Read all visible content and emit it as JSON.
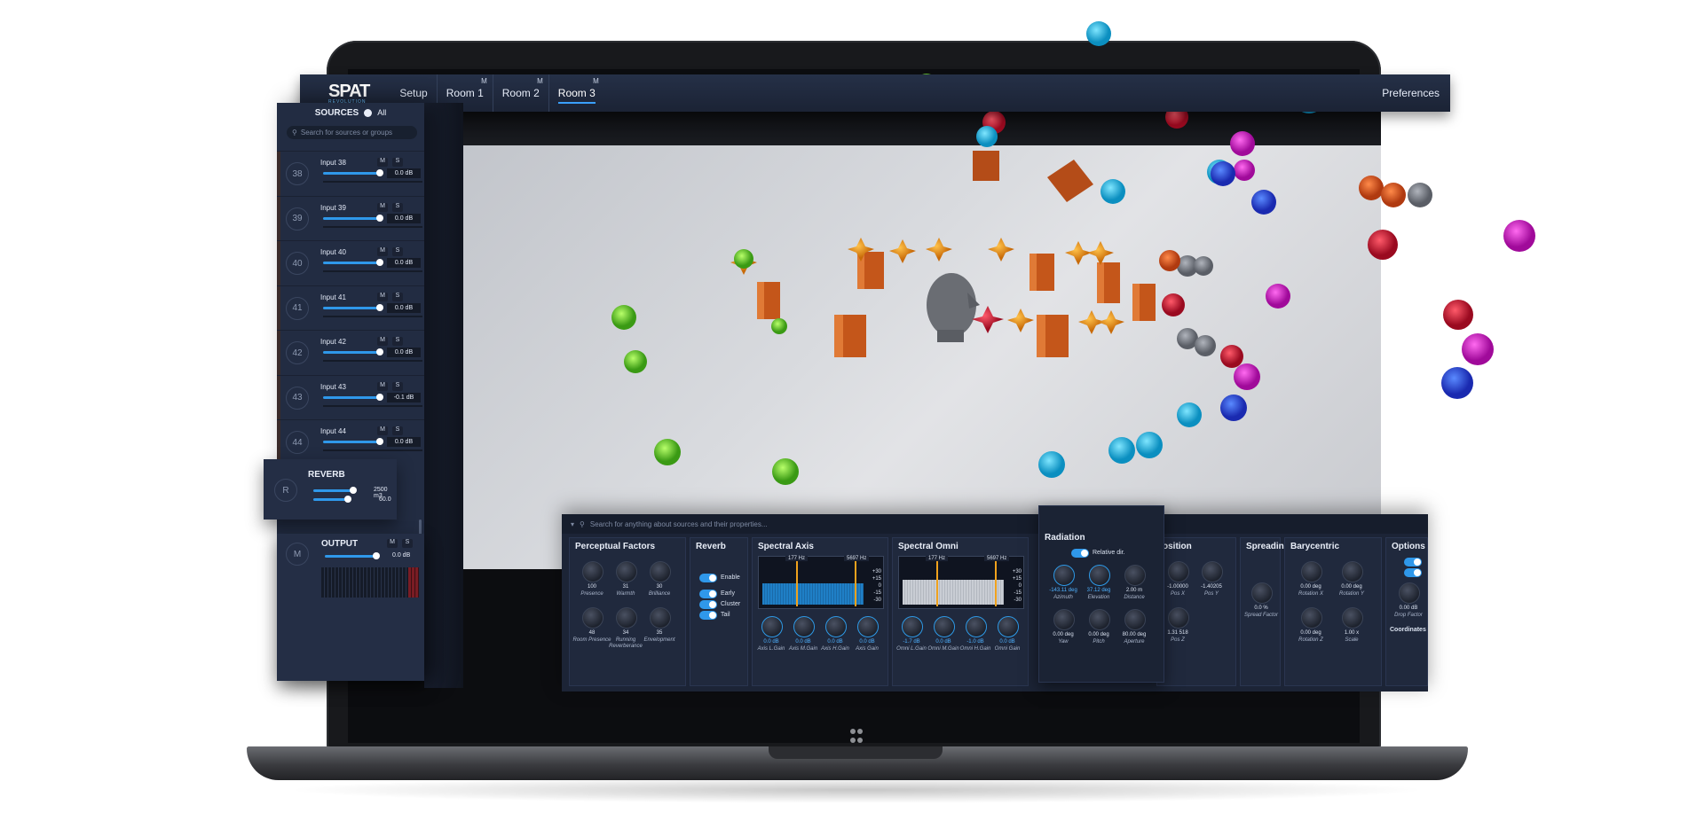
{
  "app": {
    "logo": "SPAT",
    "logo_sub": "REVOLUTION",
    "menu": [
      {
        "label": "Setup",
        "badge": ""
      },
      {
        "label": "Room 1",
        "badge": "M"
      },
      {
        "label": "Room 2",
        "badge": "M"
      },
      {
        "label": "Room 3",
        "badge": "M"
      }
    ],
    "preferences": "Preferences"
  },
  "sources": {
    "title": "SOURCES",
    "all_label": "All",
    "search_placeholder": "Search for sources or groups",
    "items": [
      {
        "num": "38",
        "name": "Input 38",
        "m": "M",
        "s": "S",
        "value": "0.0 dB"
      },
      {
        "num": "39",
        "name": "Input 39",
        "m": "M",
        "s": "S",
        "value": "0.0 dB"
      },
      {
        "num": "40",
        "name": "Input 40",
        "m": "M",
        "s": "S",
        "value": "0.0 dB"
      },
      {
        "num": "41",
        "name": "Input 41",
        "m": "M",
        "s": "S",
        "value": "0.0 dB"
      },
      {
        "num": "42",
        "name": "Input 42",
        "m": "M",
        "s": "S",
        "value": "0.0 dB"
      },
      {
        "num": "43",
        "name": "Input 43",
        "m": "M",
        "s": "S",
        "value": "-0.1 dB"
      },
      {
        "num": "44",
        "name": "Input 44",
        "m": "M",
        "s": "S",
        "value": "0.0 dB"
      }
    ]
  },
  "reverb": {
    "badge": "R",
    "title": "REVERB",
    "volume": "2500 m3",
    "value2": "60.0"
  },
  "output": {
    "badge": "M",
    "title": "OUTPUT",
    "m": "M",
    "s": "S",
    "value": "0.0 dB"
  },
  "props": {
    "search_placeholder": "Search for anything about sources and their properties...",
    "perceptual": {
      "title": "Perceptual Factors",
      "knobs": [
        {
          "value": "100",
          "label": "Presence"
        },
        {
          "value": "31",
          "label": "Warmth"
        },
        {
          "value": "30",
          "label": "Brilliance"
        },
        {
          "value": "48",
          "label": "Room Presence"
        },
        {
          "value": "34",
          "label": "Running Reverberance"
        },
        {
          "value": "35",
          "label": "Envelopment"
        }
      ]
    },
    "reverb": {
      "title": "Reverb",
      "enable": "Enable",
      "early": "Early",
      "cluster": "Cluster",
      "tail": "Tail"
    },
    "spectral_axis": {
      "title": "Spectral Axis",
      "low_tag": "177 Hz",
      "high_tag": "5697 Hz",
      "scale": [
        "+30",
        "+15",
        "0",
        "-15",
        "-30"
      ],
      "knobs": [
        {
          "value": "0.0 dB",
          "label": "Axis L.Gain"
        },
        {
          "value": "0.0 dB",
          "label": "Axis M.Gain"
        },
        {
          "value": "0.0 dB",
          "label": "Axis H.Gain"
        },
        {
          "value": "0.0 dB",
          "label": "Axis Gain"
        }
      ]
    },
    "spectral_omni": {
      "title": "Spectral Omni",
      "low_tag": "177 Hz",
      "high_tag": "5697 Hz",
      "scale": [
        "+30",
        "+15",
        "0",
        "-15",
        "-30"
      ],
      "knobs": [
        {
          "value": "-1.7 dB",
          "label": "Omni L.Gain"
        },
        {
          "value": "0.0 dB",
          "label": "Omni M.Gain"
        },
        {
          "value": "-1.0 dB",
          "label": "Omni H.Gain"
        },
        {
          "value": "0.0 dB",
          "label": "Omni Gain"
        }
      ]
    },
    "radiation": {
      "title": "Radiation",
      "relative": "Relative dir.",
      "knobs": [
        {
          "value": "-143.11 deg",
          "label": "Azimuth"
        },
        {
          "value": "37.12 deg",
          "label": "Elevation"
        },
        {
          "value": "2.00 m",
          "label": "Distance"
        },
        {
          "value": "0.00 deg",
          "label": "Yaw"
        },
        {
          "value": "0.00 deg",
          "label": "Pitch"
        },
        {
          "value": "80.00 deg",
          "label": "Aperture"
        }
      ]
    },
    "position": {
      "title": "osition",
      "knobs": [
        {
          "value": "-1.00000",
          "label": "Pos X"
        },
        {
          "value": "-1.40205",
          "label": "Pos Y"
        },
        {
          "value": "1.31 518",
          "label": "Pos Z"
        }
      ]
    },
    "spreading": {
      "title": "Spreading",
      "value": "0.0 %",
      "label": "Spread Factor"
    },
    "barycentric": {
      "title": "Barycentric",
      "knobs": [
        {
          "value": "0.00 deg",
          "label": "Rotation X"
        },
        {
          "value": "0.00 deg",
          "label": "Rotation Y"
        },
        {
          "value": "0.00 deg",
          "label": "Rotation Z"
        },
        {
          "value": "1.00 x",
          "label": "Scale"
        }
      ]
    },
    "options": {
      "title": "Options",
      "drop_value": "0.00 dB",
      "drop_label": "Drop Factor",
      "coordinates": "Coordinates"
    }
  }
}
